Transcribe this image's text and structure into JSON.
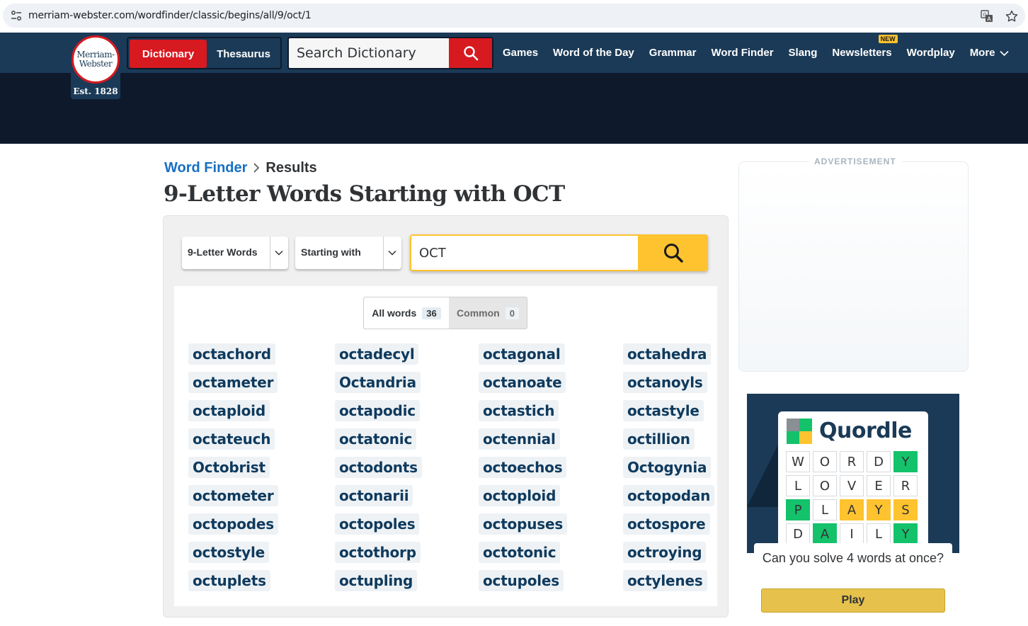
{
  "browser": {
    "url": "merriam-webster.com/wordfinder/classic/begins/all/9/oct/1",
    "icons": [
      "site-info-icon",
      "translate-icon",
      "bookmark-star-icon"
    ]
  },
  "header": {
    "logo_line1": "Merriam-",
    "logo_line2": "Webster",
    "logo_est": "Est. 1828",
    "tab_dictionary": "Dictionary",
    "tab_thesaurus": "Thesaurus",
    "search_placeholder": "Search Dictionary",
    "nav": [
      {
        "label": "Games"
      },
      {
        "label": "Word of the Day"
      },
      {
        "label": "Grammar"
      },
      {
        "label": "Word Finder"
      },
      {
        "label": "Slang"
      },
      {
        "label": "Newsletters",
        "badge": "NEW"
      },
      {
        "label": "Wordplay"
      },
      {
        "label": "More"
      }
    ]
  },
  "breadcrumb": {
    "link": "Word Finder",
    "current": "Results"
  },
  "page_title": "9-Letter Words Starting with OCT",
  "finder": {
    "length_select": "9-Letter Words",
    "mode_select": "Starting with",
    "letters_value": "OCT",
    "toggle": {
      "all_label": "All words",
      "all_count": "36",
      "common_label": "Common",
      "common_count": "0"
    },
    "words": [
      "octachord",
      "octadecyl",
      "octagonal",
      "octahedra",
      "octameter",
      "Octandria",
      "octanoate",
      "octanoyls",
      "octaploid",
      "octapodic",
      "octastich",
      "octastyle",
      "octateuch",
      "octatonic",
      "octennial",
      "octillion",
      "Octobrist",
      "octodonts",
      "octoechos",
      "Octogynia",
      "octometer",
      "octonarii",
      "octoploid",
      "octopodan",
      "octopodes",
      "octopoles",
      "octopuses",
      "octospore",
      "octostyle",
      "octothorp",
      "octotonic",
      "octroying",
      "octuplets",
      "octupling",
      "octupoles",
      "octylenes"
    ]
  },
  "sidebar": {
    "ad_label": "ADVERTISEMENT",
    "promo": {
      "title": "Quordle",
      "grid": [
        [
          {
            "l": "W",
            "c": ""
          },
          {
            "l": "O",
            "c": ""
          },
          {
            "l": "R",
            "c": ""
          },
          {
            "l": "D",
            "c": ""
          },
          {
            "l": "Y",
            "c": "g"
          }
        ],
        [
          {
            "l": "L",
            "c": ""
          },
          {
            "l": "O",
            "c": ""
          },
          {
            "l": "V",
            "c": ""
          },
          {
            "l": "E",
            "c": ""
          },
          {
            "l": "R",
            "c": ""
          }
        ],
        [
          {
            "l": "P",
            "c": "g"
          },
          {
            "l": "L",
            "c": ""
          },
          {
            "l": "A",
            "c": "y"
          },
          {
            "l": "Y",
            "c": "y"
          },
          {
            "l": "S",
            "c": "y"
          }
        ],
        [
          {
            "l": "D",
            "c": ""
          },
          {
            "l": "A",
            "c": "g"
          },
          {
            "l": "I",
            "c": ""
          },
          {
            "l": "L",
            "c": ""
          },
          {
            "l": "Y",
            "c": "g"
          }
        ]
      ],
      "text": "Can you solve 4 words at once?",
      "button": "Play"
    }
  },
  "colors": {
    "nav_bg": "#1a3a57",
    "header_dark": "#0e1a2c",
    "brand_red": "#d71920",
    "accent_yellow": "#fec32f",
    "link_blue": "#1670c4",
    "quordle_green": "#14c26b"
  }
}
